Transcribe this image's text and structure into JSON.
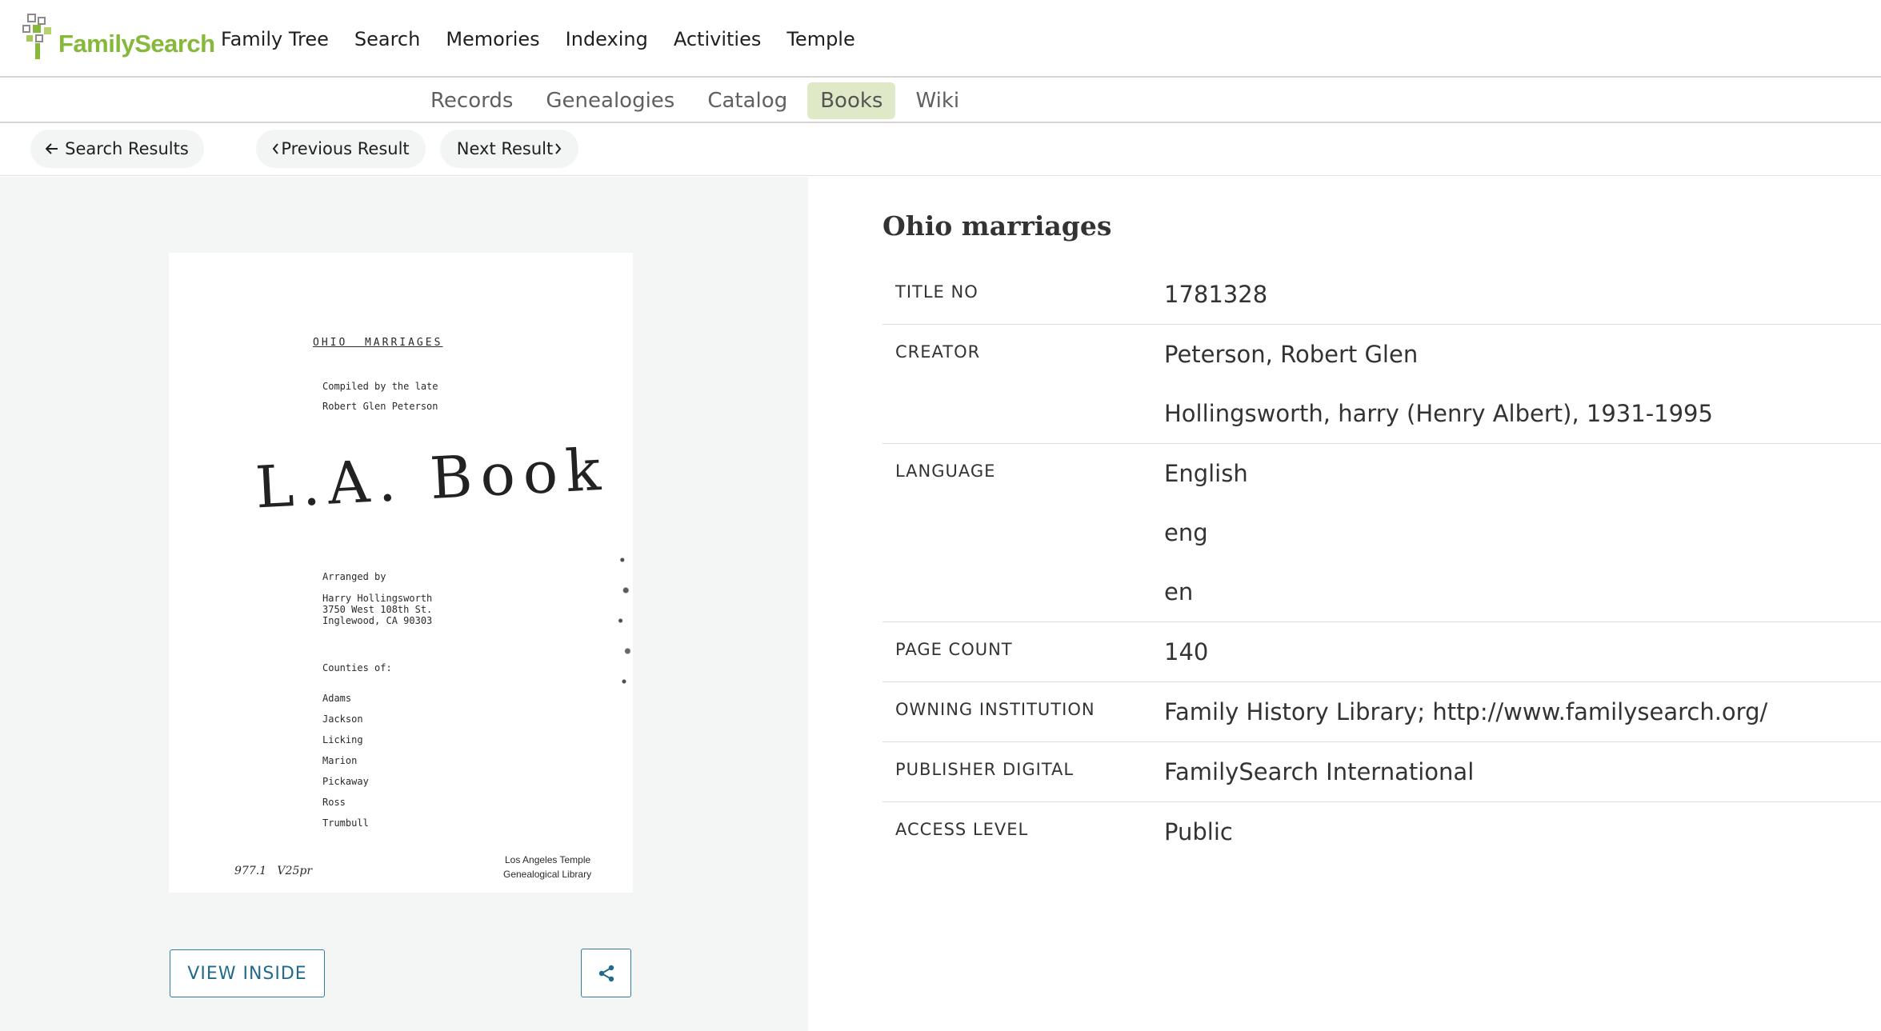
{
  "app": {
    "logo_text": "FamilySearch",
    "brand_color": "#86b83a"
  },
  "primary_nav": [
    {
      "label": "Family Tree"
    },
    {
      "label": "Search"
    },
    {
      "label": "Memories"
    },
    {
      "label": "Indexing"
    },
    {
      "label": "Activities"
    },
    {
      "label": "Temple"
    }
  ],
  "sub_nav": [
    {
      "label": "Records",
      "active": false
    },
    {
      "label": "Genealogies",
      "active": false
    },
    {
      "label": "Catalog",
      "active": false
    },
    {
      "label": "Books",
      "active": true
    },
    {
      "label": "Wiki",
      "active": false
    }
  ],
  "result_nav": {
    "back_label": "Search Results",
    "back_icon": "arrow-left-icon",
    "prev_label": "Previous Result",
    "next_label": "Next Result"
  },
  "book_cover": {
    "title": "OHIO  MARRIAGES",
    "compiled": "Compiled by the late",
    "compiler": "Robert Glen Peterson",
    "handwritten": "L.A. Book",
    "arranged": "Arranged by",
    "address": [
      "Harry Hollingsworth",
      "3750 West 108th St.",
      "Inglewood, CA 90303"
    ],
    "counties_heading": "Counties of:",
    "counties": [
      "Adams",
      "Jackson",
      "Licking",
      "Marion",
      "Pickaway",
      "Ross",
      "Trumbull"
    ],
    "call_number": "977.1   V25pr",
    "library_line1": "Los Angeles Temple",
    "library_line2": "Genealogical Library"
  },
  "actions": {
    "view_inside_label": "VIEW INSIDE",
    "share_icon": "share-icon",
    "accent_color": "#2e7ca0"
  },
  "record": {
    "title": "Ohio marriages",
    "fields": [
      {
        "label": "TITLE NO",
        "values": [
          "1781328"
        ]
      },
      {
        "label": "CREATOR",
        "values": [
          "Peterson, Robert Glen",
          "Hollingsworth, harry (Henry Albert), 1931-1995"
        ]
      },
      {
        "label": "LANGUAGE",
        "values": [
          "English",
          "eng",
          "en"
        ]
      },
      {
        "label": "PAGE COUNT",
        "values": [
          "140"
        ]
      },
      {
        "label": "OWNING INSTITUTION",
        "values": [
          "Family History Library; http://www.familysearch.org/"
        ]
      },
      {
        "label": "PUBLISHER DIGITAL",
        "values": [
          "FamilySearch International"
        ]
      },
      {
        "label": "ACCESS LEVEL",
        "values": [
          "Public"
        ]
      }
    ]
  }
}
